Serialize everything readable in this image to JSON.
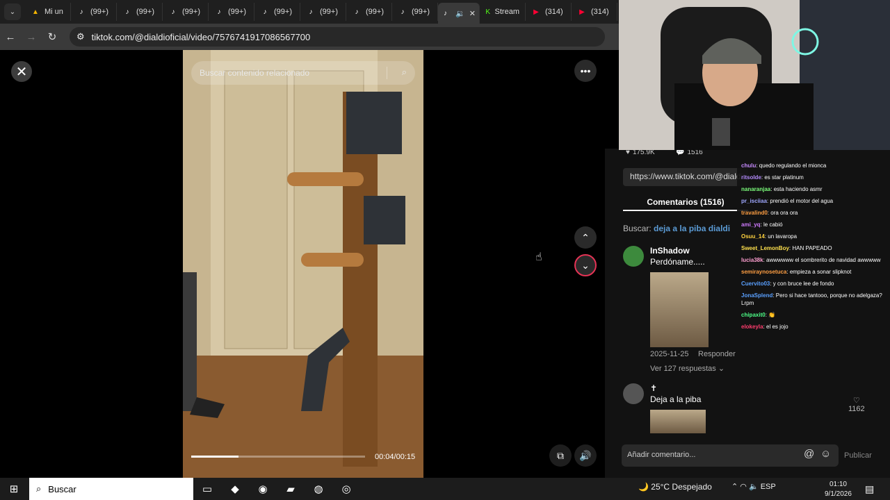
{
  "browser": {
    "tabs": [
      {
        "icon": "drive-icon",
        "label": "Mi un"
      },
      {
        "icon": "tiktok-icon",
        "label": "(99+)"
      },
      {
        "icon": "tiktok-icon",
        "label": "(99+)"
      },
      {
        "icon": "tiktok-icon",
        "label": "(99+)"
      },
      {
        "icon": "tiktok-icon",
        "label": "(99+)"
      },
      {
        "icon": "tiktok-icon",
        "label": "(99+)"
      },
      {
        "icon": "tiktok-icon",
        "label": "(99+)"
      },
      {
        "icon": "tiktok-icon",
        "label": "(99+)"
      },
      {
        "icon": "tiktok-icon",
        "label": "(99+)"
      },
      {
        "icon": "tiktok-icon",
        "label": ""
      },
      {
        "icon": "kick-icon",
        "label": "Stream"
      },
      {
        "icon": "youtube-icon",
        "label": "(314)"
      },
      {
        "icon": "youtube-icon",
        "label": "(314)"
      }
    ],
    "url": "tiktok.com/@dialdioficial/video/7576741917086567700"
  },
  "video": {
    "search_placeholder": "Buscar contenido relacionado",
    "time": "00:04/00:15",
    "progress_fraction": 0.27
  },
  "side": {
    "likes": "175.9K",
    "comments": "1516",
    "link": "https://www.tiktok.com/@dialdi",
    "comments_tab": "Comentarios (1516)",
    "buscar_label": "Buscar:",
    "buscar_query": "deja a la piba dialdi",
    "comment1": {
      "name": "InShadow",
      "text": "Perdóname.....",
      "date": "2025-11-25",
      "reply": "Responder",
      "more": "Ver 127 respuestas"
    },
    "comment2": {
      "name": "✝",
      "text": "Deja a la piba",
      "likes": "1162"
    },
    "add_placeholder": "Añadir comentario...",
    "publish": "Publicar"
  },
  "chat": [
    {
      "user": "chulu",
      "color": "#c78bff",
      "text": ": quedo regulando el mionca"
    },
    {
      "user": "ritsolde",
      "color": "#b58cff",
      "text": ": es star platinum"
    },
    {
      "user": "nanaranjaa",
      "color": "#7cff7c",
      "text": ": esta haciendo asmr"
    },
    {
      "user": "pr_isciiaa",
      "color": "#9fa8ff",
      "text": ": prendió el motor del agua"
    },
    {
      "user": "travalind0",
      "color": "#ff9f43",
      "text": ": ora ora ora"
    },
    {
      "user": "ami_yq",
      "color": "#d07bff",
      "text": ": le cabió"
    },
    {
      "user": "Osuu_14",
      "color": "#ffd23f",
      "text": ": un lavaropa"
    },
    {
      "user": "Sweet_LemonBoy",
      "color": "#ffe14d",
      "text": ": HAN PAPEADO"
    },
    {
      "user": "lucia38k",
      "color": "#ff9fd1",
      "text": ": awwwwww el sombrerito de navidad awwwww"
    },
    {
      "user": "semiraynosetuca",
      "color": "#ff9f43",
      "text": ": empieza a sonar slipknot"
    },
    {
      "user": "Cuervito03",
      "color": "#5aa0ff",
      "text": ": y con bruce lee de fondo"
    },
    {
      "user": "JonaSplend",
      "color": "#5aa0ff",
      "text": ": Pero si hace tantooo, porque no adelgaza? Lrpm"
    },
    {
      "user": "chipaxit0",
      "color": "#4dff88",
      "text": ": 👏"
    },
    {
      "user": "elokeyla",
      "color": "#ff3d6e",
      "text": ": el es jojo"
    }
  ],
  "taskbar": {
    "search": "Buscar",
    "weather": "25°C  Despejado",
    "lang": "ESP",
    "time": "01:10",
    "date": "9/1/2026"
  }
}
